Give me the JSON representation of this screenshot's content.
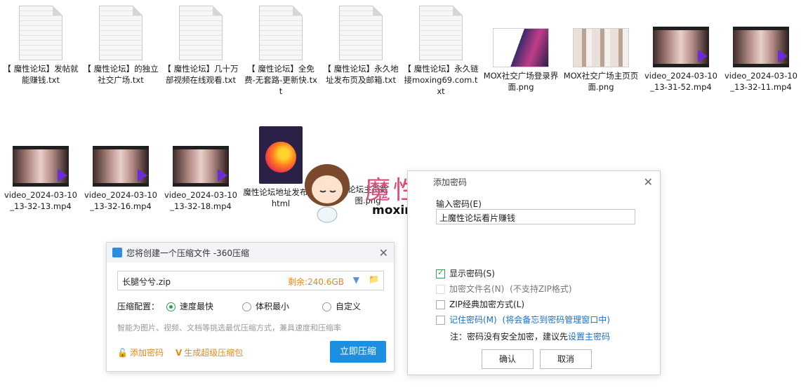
{
  "files": [
    {
      "name": "【 魔性论坛】发帖就能赚钱.txt",
      "type": "txt"
    },
    {
      "name": "【 魔性论坛】的独立社交广场.txt",
      "type": "txt"
    },
    {
      "name": "【 魔性论坛】几十万部视频在线观看.txt",
      "type": "txt"
    },
    {
      "name": "【 魔性论坛】全免费-无套路-更新快.txt",
      "type": "txt"
    },
    {
      "name": "【 魔性论坛】永久地址发布页及邮箱.txt",
      "type": "txt"
    },
    {
      "name": "【 魔性论坛】永久链接moxing69.com.txt",
      "type": "txt"
    },
    {
      "name": "MOX社交广场登录界面.png",
      "type": "png"
    },
    {
      "name": "MOX社交广场主页页面.png",
      "type": "png"
    },
    {
      "name": "video_2024-03-10_13-31-52.mp4",
      "type": "mp4"
    },
    {
      "name": "video_2024-03-10_13-32-11.mp4",
      "type": "mp4"
    },
    {
      "name": "video_2024-03-10_13-32-13.mp4",
      "type": "mp4"
    },
    {
      "name": "video_2024-03-10_13-32-16.mp4",
      "type": "mp4"
    },
    {
      "name": "video_2024-03-10_13-32-18.mp4",
      "type": "mp4"
    },
    {
      "name": "魔性论坛地址发布器.html",
      "type": "html"
    },
    {
      "name": "论坛主页截图.png",
      "type": "png"
    }
  ],
  "watermark": {
    "title": "魔性论坛",
    "url": "moxing69.com"
  },
  "zip_dialog": {
    "title": "您将创建一个压缩文件 -360压缩",
    "filename": "长腿兮兮.zip",
    "free_space": "剩余:240.6GB",
    "config_label": "压缩配置：",
    "options": [
      "速度最快",
      "体积最小",
      "自定义"
    ],
    "selected_option": "速度最快",
    "hint": "智能为图片、视频、文档等挑选最优压缩方式，兼具速度和压缩率",
    "add_password": "添加密码",
    "super_zip": "生成超级压缩包",
    "compress_button": "立即压缩"
  },
  "pwd_dialog": {
    "title": "添加密码",
    "input_label": "输入密码(E)",
    "password_value": "上魔性论坛看片赚钱",
    "show_password": "显示密码(S)",
    "encrypt_names": "加密文件名(N)",
    "encrypt_names_note": "(不支持ZIP格式)",
    "zip_classic": "ZIP经典加密方式(L)",
    "remember": "记住密码(M)",
    "remember_note": "(将会备忘到密码管理窗口中)",
    "note_prefix": "注：密码没有安全加密，建议先",
    "note_link": "设置主密码",
    "ok": "确认",
    "cancel": "取消"
  },
  "colors": {
    "accent": "#1d8fe0",
    "brand_watermark": "#e04a7a",
    "orange": "#e08a1e"
  }
}
